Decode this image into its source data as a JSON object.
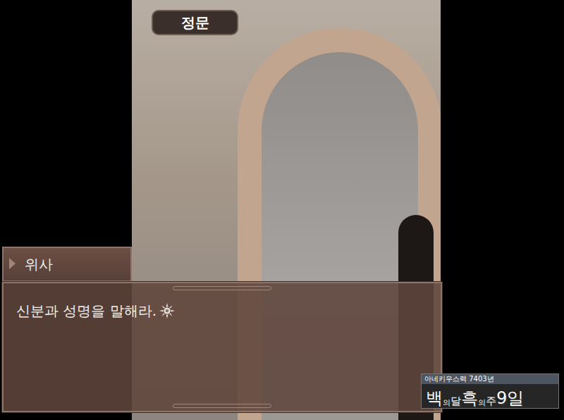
{
  "location": "정문",
  "speaker": "위사",
  "dialogue": "신분과 성명을 말해라.",
  "date": {
    "era": "아네키우스력 7403년",
    "parts": [
      {
        "text": "백",
        "kind": "big"
      },
      {
        "text": "의",
        "kind": "small"
      },
      {
        "text": "달",
        "kind": "mid"
      },
      {
        "text": "흑",
        "kind": "big"
      },
      {
        "text": "의",
        "kind": "small"
      },
      {
        "text": "주",
        "kind": "mid"
      },
      {
        "text": "9일",
        "kind": "big"
      }
    ]
  }
}
